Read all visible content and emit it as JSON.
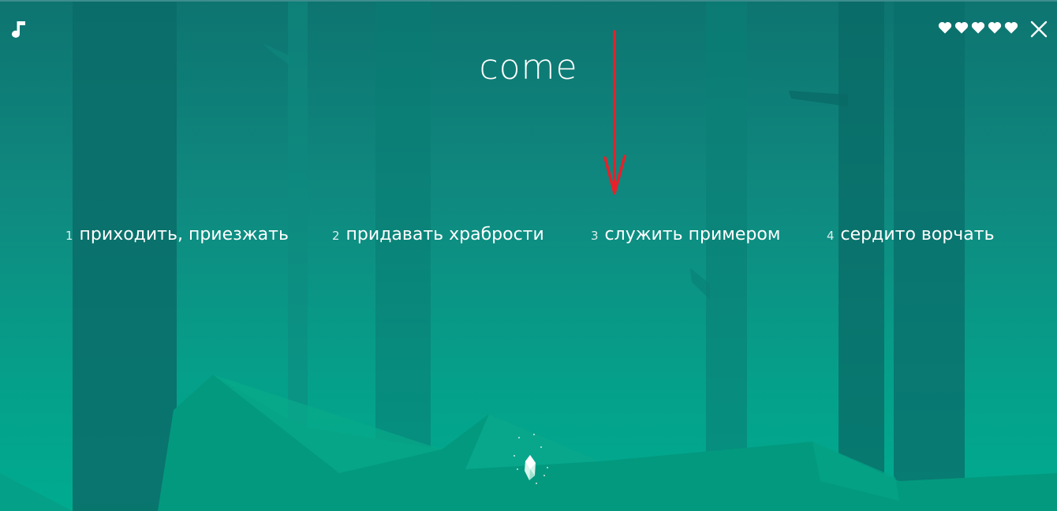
{
  "game": {
    "word": "come",
    "options": [
      {
        "number": "1",
        "label": "приходить, приезжать"
      },
      {
        "number": "2",
        "label": "придавать храбрости"
      },
      {
        "number": "3",
        "label": "служить примером"
      },
      {
        "number": "4",
        "label": "сердито ворчать"
      }
    ],
    "lives": 5,
    "max_lives": 5
  },
  "icons": {
    "music": "music-note-icon",
    "heart": "heart-icon",
    "close": "close-icon",
    "crystal": "crystal-icon",
    "arrow": "red-arrow-annotation"
  },
  "colors": {
    "background_top": "#0e7470",
    "background_bottom": "#00ab8f",
    "text": "#ffffff",
    "annotation": "#e8202a"
  }
}
